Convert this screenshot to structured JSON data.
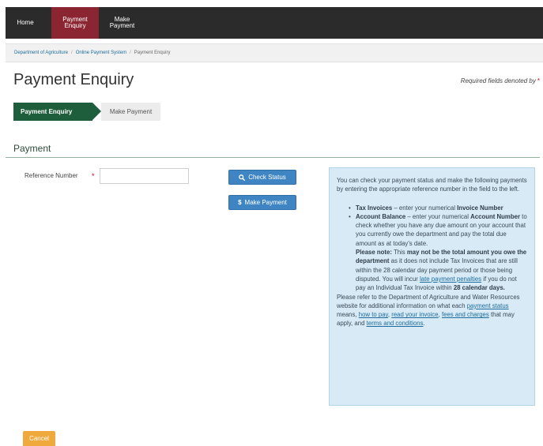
{
  "nav": {
    "home": "Home",
    "payment_enquiry": "Payment Enquiry",
    "make_payment": "Make Payment",
    "active_color": "#8b2531"
  },
  "breadcrumb": {
    "items": [
      "Department of Agriculture",
      "Online Payment System"
    ],
    "current": "Payment Enquiry"
  },
  "page": {
    "title": "Payment Enquiry",
    "required_note": "Required fields denoted by",
    "required_star": "*"
  },
  "steps": {
    "active": "Payment Enquiry",
    "next": "Make Payment",
    "active_color": "#1f5e3c"
  },
  "section": {
    "title": "Payment"
  },
  "form": {
    "reference_label": "Reference Number",
    "reference_star": "*",
    "reference_value": "",
    "check_status_icon": "search-icon",
    "check_status_label": "Check Status",
    "make_payment_icon": "dollar-icon",
    "make_payment_label": "Make Payment",
    "button_color": "#3f85c3"
  },
  "info": {
    "intro": "You can check your payment status and make the following payments by entering the appropriate reference number in the field to the left.",
    "bullet1": {
      "term": "Tax Invoices",
      "dash": " – enter your numerical ",
      "key": "Invoice Number"
    },
    "bullet2": {
      "term": "Account Balance",
      "dash": " – enter your numerical ",
      "key": "Account Number",
      "rest": " to check whether you have any due amount on your account that you currently owe the department and pay the total due amount as at today's date."
    },
    "note": {
      "label": "Please note:",
      "t1": " This ",
      "b1": "may not be the total amount you owe the department",
      "t2": " as it does not include Tax Invoices that are still within the 28 calendar day payment period or those being disputed. You will incur ",
      "link": "late payment penalties",
      "t3": " if you do not pay an Individual Tax Invoice within ",
      "b2": "28 calendar days."
    },
    "footer": {
      "t1": "Please refer to the Department of Agriculture and Water Resources website for additional information on what each ",
      "link1": "payment status",
      "t2": " means, ",
      "link2": "how to pay",
      "t3": ", ",
      "link3": "read your invoice",
      "t4": ", ",
      "link4": "fees and charges",
      "t5": " that may apply, and ",
      "link5": "terms and conditions",
      "t6": "."
    }
  },
  "cancel": {
    "label": "Cancel",
    "color": "#f0a93c"
  }
}
